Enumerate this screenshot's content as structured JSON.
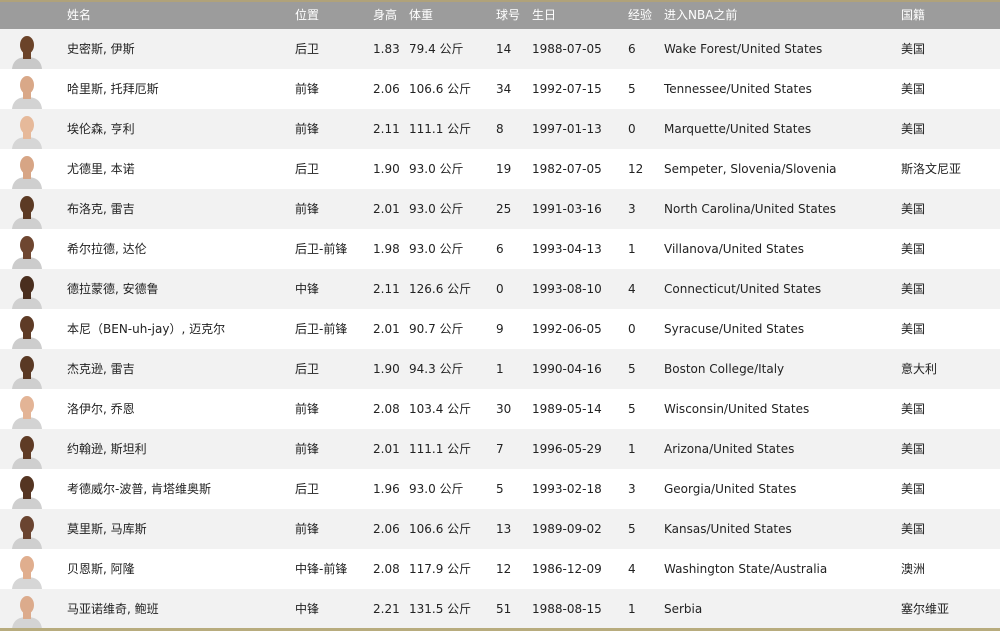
{
  "header": {
    "name": "姓名",
    "position": "位置",
    "height": "身高",
    "weight": "体重",
    "number": "球号",
    "birthday": "生日",
    "experience": "经验",
    "pre_nba": "进入NBA之前",
    "nationality": "国籍"
  },
  "rows": [
    {
      "name": "史密斯, 伊斯",
      "position": "后卫",
      "height": "1.83",
      "weight": "79.4 公斤",
      "number": "14",
      "birthday": "1988-07-05",
      "experience": "6",
      "pre_nba": "Wake Forest/United States",
      "nationality": "美国",
      "skin": "#6b4329",
      "jersey": "#c9c9c9"
    },
    {
      "name": "哈里斯, 托拜厄斯",
      "position": "前锋",
      "height": "2.06",
      "weight": "106.6 公斤",
      "number": "34",
      "birthday": "1992-07-15",
      "experience": "5",
      "pre_nba": "Tennessee/United States",
      "nationality": "美国",
      "skin": "#d9a888",
      "jersey": "#d3d3d3"
    },
    {
      "name": "埃伦森, 亨利",
      "position": "前锋",
      "height": "2.11",
      "weight": "111.1 公斤",
      "number": "8",
      "birthday": "1997-01-13",
      "experience": "0",
      "pre_nba": "Marquette/United States",
      "nationality": "美国",
      "skin": "#e6b99a",
      "jersey": "#d6d6d6"
    },
    {
      "name": "尤德里, 本诺",
      "position": "后卫",
      "height": "1.90",
      "weight": "93.0 公斤",
      "number": "19",
      "birthday": "1982-07-05",
      "experience": "12",
      "pre_nba": "Sempeter, Slovenia/Slovenia",
      "nationality": "斯洛文尼亚",
      "skin": "#d7a585",
      "jersey": "#cfcfcf"
    },
    {
      "name": "布洛克, 雷吉",
      "position": "前锋",
      "height": "2.01",
      "weight": "93.0 公斤",
      "number": "25",
      "birthday": "1991-03-16",
      "experience": "3",
      "pre_nba": "North Carolina/United States",
      "nationality": "美国",
      "skin": "#5c3a24",
      "jersey": "#cfcfcf"
    },
    {
      "name": "希尔拉德, 达伦",
      "position": "后卫-前锋",
      "height": "1.98",
      "weight": "93.0 公斤",
      "number": "6",
      "birthday": "1993-04-13",
      "experience": "1",
      "pre_nba": "Villanova/United States",
      "nationality": "美国",
      "skin": "#6e4630",
      "jersey": "#cccccc"
    },
    {
      "name": "德拉蒙德, 安德鲁",
      "position": "中锋",
      "height": "2.11",
      "weight": "126.6 公斤",
      "number": "0",
      "birthday": "1993-08-10",
      "experience": "4",
      "pre_nba": "Connecticut/United States",
      "nationality": "美国",
      "skin": "#4a2e1e",
      "jersey": "#d0d0d0"
    },
    {
      "name": "本尼（BEN-uh-jay）, 迈克尔",
      "position": "后卫-前锋",
      "height": "2.01",
      "weight": "90.7 公斤",
      "number": "9",
      "birthday": "1992-06-05",
      "experience": "0",
      "pre_nba": "Syracuse/United States",
      "nationality": "美国",
      "skin": "#5e3b26",
      "jersey": "#cdcdcd"
    },
    {
      "name": "杰克逊, 雷吉",
      "position": "后卫",
      "height": "1.90",
      "weight": "94.3 公斤",
      "number": "1",
      "birthday": "1990-04-16",
      "experience": "5",
      "pre_nba": "Boston College/Italy",
      "nationality": "意大利",
      "skin": "#5a3924",
      "jersey": "#cfcfcf"
    },
    {
      "name": "洛伊尔, 乔恩",
      "position": "前锋",
      "height": "2.08",
      "weight": "103.4 公斤",
      "number": "30",
      "birthday": "1989-05-14",
      "experience": "5",
      "pre_nba": "Wisconsin/United States",
      "nationality": "美国",
      "skin": "#e3b496",
      "jersey": "#d3d3d3"
    },
    {
      "name": "约翰逊, 斯坦利",
      "position": "前锋",
      "height": "2.01",
      "weight": "111.1 公斤",
      "number": "7",
      "birthday": "1996-05-29",
      "experience": "1",
      "pre_nba": "Arizona/United States",
      "nationality": "美国",
      "skin": "#5f3b25",
      "jersey": "#cfcfcf"
    },
    {
      "name": "考德威尔-波普, 肯塔维奥斯",
      "position": "后卫",
      "height": "1.96",
      "weight": "93.0 公斤",
      "number": "5",
      "birthday": "1993-02-18",
      "experience": "3",
      "pre_nba": "Georgia/United States",
      "nationality": "美国",
      "skin": "#553522",
      "jersey": "#cfcfcf"
    },
    {
      "name": "莫里斯, 马库斯",
      "position": "前锋",
      "height": "2.06",
      "weight": "106.6 公斤",
      "number": "13",
      "birthday": "1989-09-02",
      "experience": "5",
      "pre_nba": "Kansas/United States",
      "nationality": "美国",
      "skin": "#6a4430",
      "jersey": "#cfcfcf"
    },
    {
      "name": "贝恩斯, 阿隆",
      "position": "中锋-前锋",
      "height": "2.08",
      "weight": "117.9 公斤",
      "number": "12",
      "birthday": "1986-12-09",
      "experience": "4",
      "pre_nba": "Washington State/Australia",
      "nationality": "澳洲",
      "skin": "#e0ae8e",
      "jersey": "#d6d6d6"
    },
    {
      "name": "马亚诺维奇, 鲍班",
      "position": "中锋",
      "height": "2.21",
      "weight": "131.5 公斤",
      "number": "51",
      "birthday": "1988-08-15",
      "experience": "1",
      "pre_nba": "Serbia",
      "nationality": "塞尔维亚",
      "skin": "#dcab8c",
      "jersey": "#d4d4d4"
    }
  ],
  "colors": {
    "header_bg": "#9c9c9c",
    "header_text": "#ffffff",
    "row_odd": "#f2f2f2",
    "row_even": "#ffffff",
    "accent_line": "#b8ac7e"
  }
}
